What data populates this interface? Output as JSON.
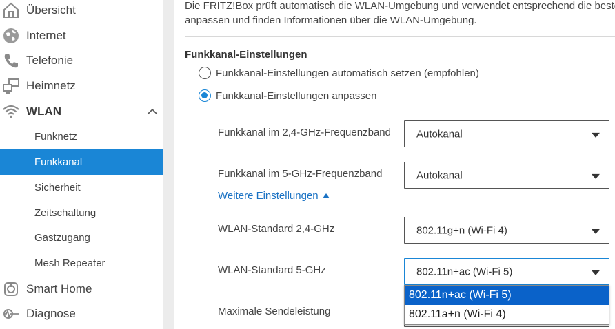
{
  "sidebar": {
    "items": [
      {
        "label": "Übersicht",
        "icon": "home-icon"
      },
      {
        "label": "Internet",
        "icon": "globe-icon"
      },
      {
        "label": "Telefonie",
        "icon": "phone-icon"
      },
      {
        "label": "Heimnetz",
        "icon": "network-icon"
      },
      {
        "label": "WLAN",
        "icon": "wifi-icon"
      },
      {
        "label": "Smart Home",
        "icon": "smart-home-icon"
      },
      {
        "label": "Diagnose",
        "icon": "diagnose-icon"
      }
    ],
    "wlan_subitems": [
      {
        "label": "Funknetz"
      },
      {
        "label": "Funkkanal",
        "active": true
      },
      {
        "label": "Sicherheit"
      },
      {
        "label": "Zeitschaltung"
      },
      {
        "label": "Gastzugang"
      },
      {
        "label": "Mesh Repeater"
      }
    ],
    "active_color": "#1a86d6"
  },
  "main": {
    "intro_line1": "Die FRITZ!Box prüft automatisch die WLAN-Umgebung und verwendet entsprechend die beste",
    "intro_line2": "anpassen und finden Informationen über die WLAN-Umgebung.",
    "section_title": "Funkkanal-Einstellungen",
    "radio_auto": "Funkkanal-Einstellungen automatisch setzen (empfohlen)",
    "radio_custom": "Funkkanal-Einstellungen anpassen",
    "fields": {
      "ch24_label": "Funkkanal im 2,4-GHz-Frequenzband",
      "ch24_value": "Autokanal",
      "ch5_label": "Funkkanal im 5-GHz-Frequenzband",
      "ch5_value": "Autokanal",
      "more_link": "Weitere Einstellungen",
      "std24_label": "WLAN-Standard 2,4-GHz",
      "std24_value": "802.11g+n (Wi-Fi 4)",
      "std5_label": "WLAN-Standard 5-GHz",
      "std5_value": "802.11n+ac (Wi-Fi 5)",
      "power_label": "Maximale Sendeleistung"
    },
    "std5_options": [
      "802.11n+ac (Wi-Fi 5)",
      "802.11a+n (Wi-Fi 4)"
    ]
  }
}
